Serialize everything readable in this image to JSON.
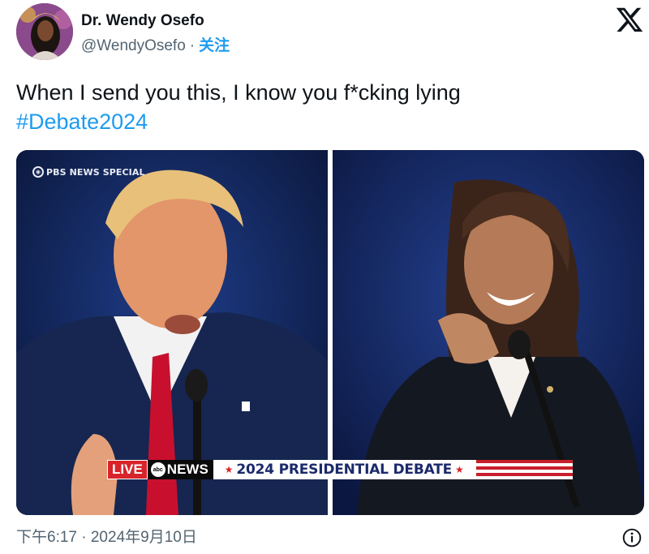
{
  "author": {
    "display_name": "Dr. Wendy Osefo",
    "handle": "@WendyOsefo",
    "separator": "·",
    "follow_label": "关注"
  },
  "tweet": {
    "text": "When I send you this, I know you f*cking lying",
    "hashtag": "#Debate2024"
  },
  "media": {
    "network_logo_text": "PBS NEWS SPECIAL",
    "chyron": {
      "live": "LIVE",
      "network": "NEWS",
      "network_badge": "abc",
      "title": "2024 PRESIDENTIAL DEBATE",
      "star": "★"
    }
  },
  "footer": {
    "timestamp": "下午6:17 · 2024年9月10日"
  },
  "icons": {
    "brand_logo": "x-logo-icon",
    "info": "info-icon"
  },
  "colors": {
    "link": "#1d9bf0",
    "secondary_text": "#536471",
    "primary_text": "#0f1419",
    "chyron_red": "#d8232a",
    "chyron_navy": "#1b2a6b"
  }
}
